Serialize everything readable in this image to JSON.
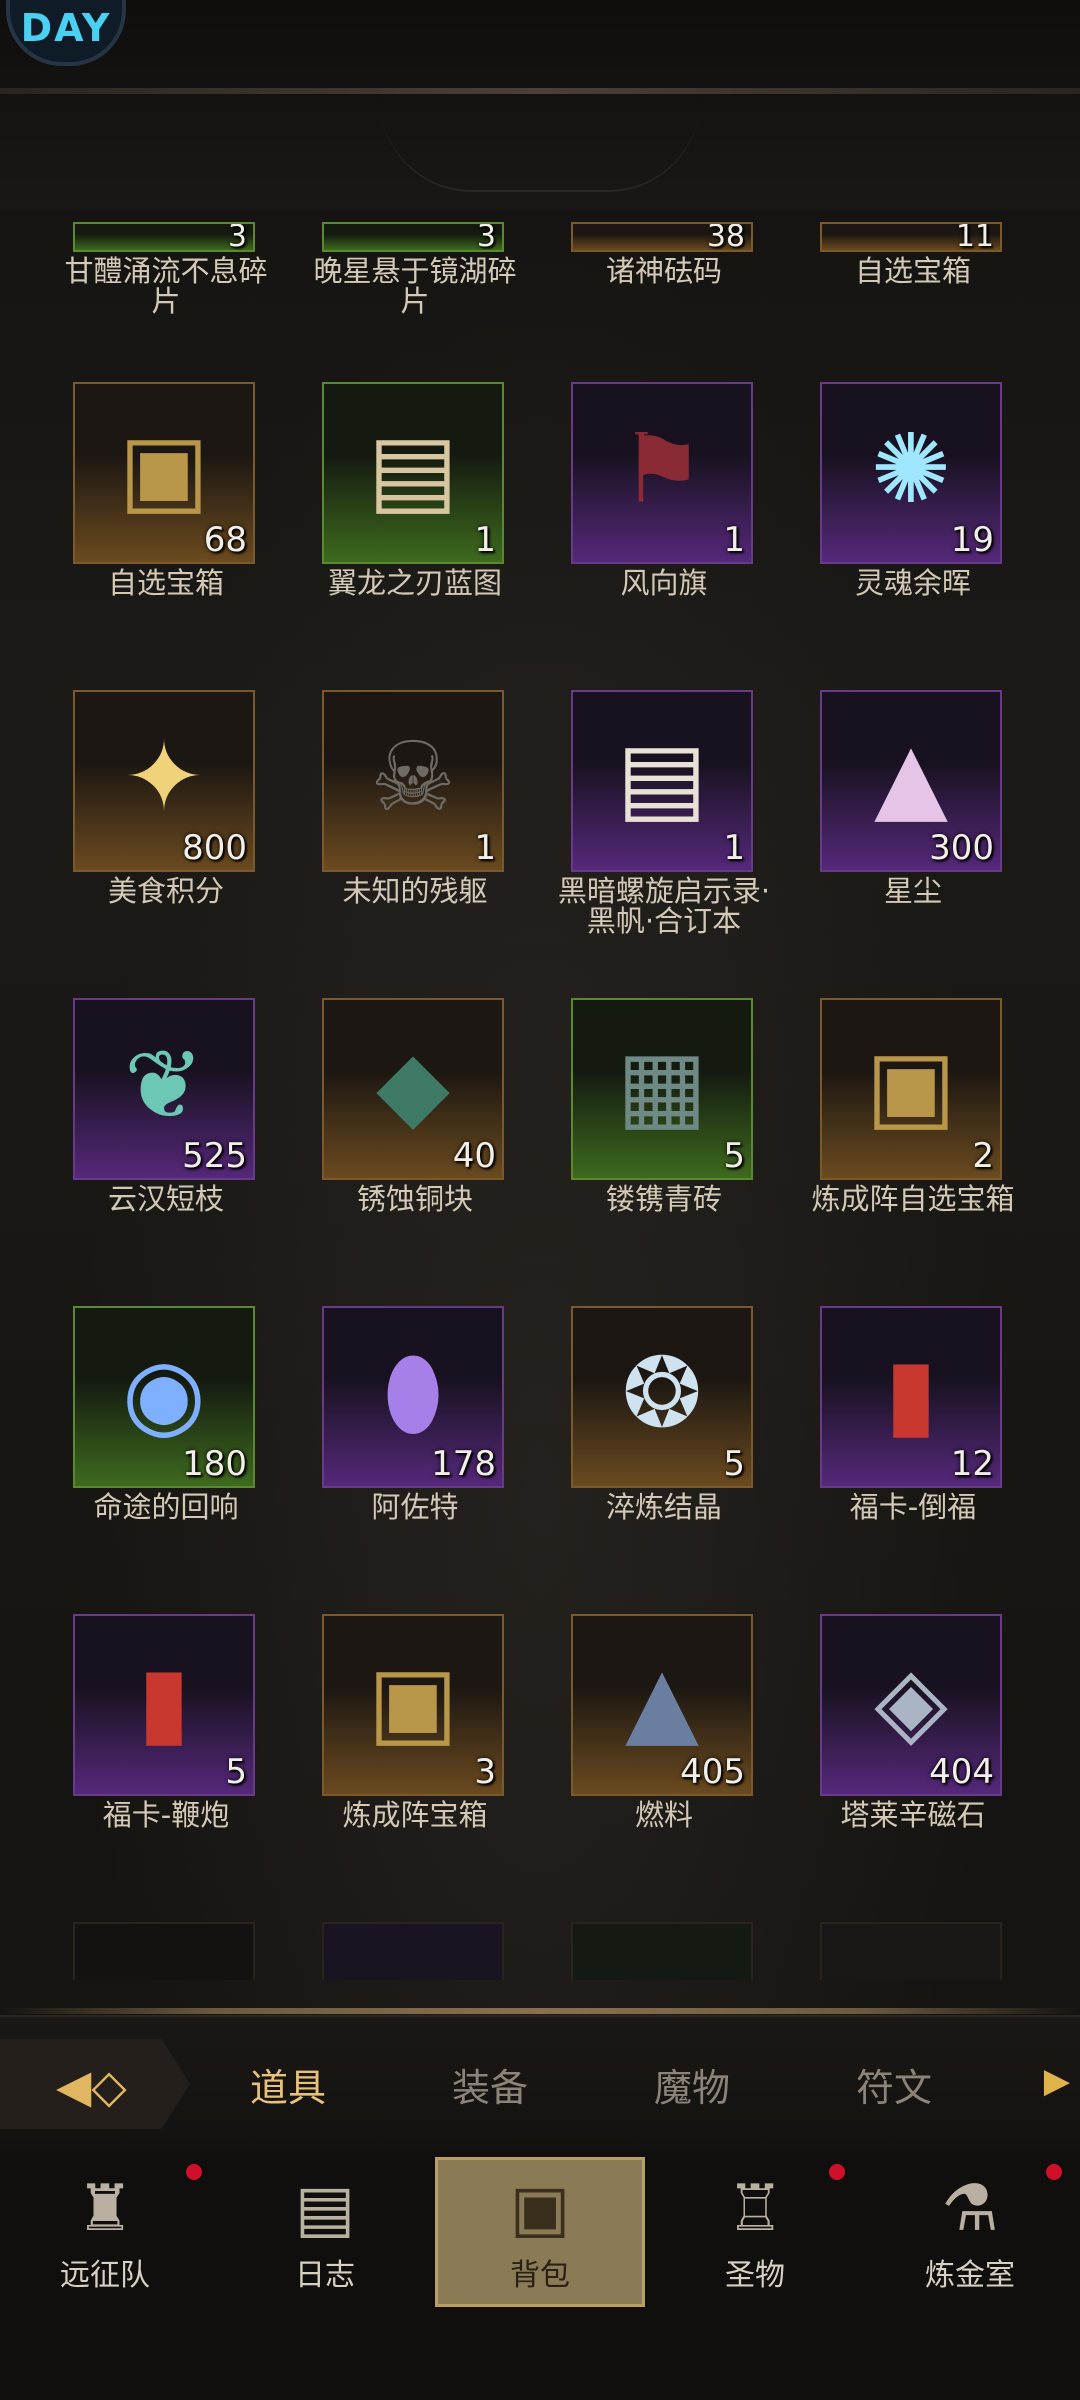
{
  "header": {
    "avatar_text": "DAY"
  },
  "inventory": {
    "row0": [
      {
        "name": "甘醴涌流不息碎片",
        "count": "3"
      },
      {
        "name": "晚星悬于镜湖碎片",
        "count": "3"
      },
      {
        "name": "诸神砝码",
        "count": "38"
      },
      {
        "name": "自选宝箱",
        "count": "11"
      }
    ],
    "row1": [
      {
        "name": "自选宝箱",
        "count": "68",
        "icon": "treasure-chest-icon"
      },
      {
        "name": "翼龙之刃蓝图",
        "count": "1",
        "icon": "scroll-blueprint-icon"
      },
      {
        "name": "风向旗",
        "count": "1",
        "icon": "banner-icon"
      },
      {
        "name": "灵魂余晖",
        "count": "19",
        "icon": "soul-glow-icon"
      }
    ],
    "row2": [
      {
        "name": "美食积分",
        "count": "800",
        "icon": "star-crystal-icon"
      },
      {
        "name": "未知的残躯",
        "count": "1",
        "icon": "skeleton-torso-icon"
      },
      {
        "name": "黑暗螺旋启示录·黑帆·合订本",
        "count": "1",
        "icon": "scroll-icon"
      },
      {
        "name": "星尘",
        "count": "300",
        "icon": "stardust-icon"
      }
    ],
    "row3": [
      {
        "name": "云汉短枝",
        "count": "525",
        "icon": "branch-icon"
      },
      {
        "name": "锈蚀铜块",
        "count": "40",
        "icon": "copper-ore-icon"
      },
      {
        "name": "镂镌青砖",
        "count": "5",
        "icon": "carved-brick-icon"
      },
      {
        "name": "炼成阵自选宝箱",
        "count": "2",
        "icon": "treasure-chest-icon"
      }
    ],
    "row4": [
      {
        "name": "命途的回响",
        "count": "180",
        "icon": "orb-flask-icon"
      },
      {
        "name": "阿佐特",
        "count": "178",
        "icon": "crystal-vial-icon"
      },
      {
        "name": "淬炼结晶",
        "count": "5",
        "icon": "rune-crystal-icon"
      },
      {
        "name": "福卡-倒福",
        "count": "12",
        "icon": "red-card-icon"
      }
    ],
    "row5": [
      {
        "name": "福卡-鞭炮",
        "count": "5",
        "icon": "red-card-icon"
      },
      {
        "name": "炼成阵宝箱",
        "count": "3",
        "icon": "treasure-chest-icon"
      },
      {
        "name": "燃料",
        "count": "405",
        "icon": "fuel-pile-icon"
      },
      {
        "name": "塔莱辛磁石",
        "count": "404",
        "icon": "lodestone-icon"
      }
    ]
  },
  "tabs": {
    "items": [
      "道具",
      "装备",
      "魔物",
      "符文"
    ],
    "active": "道具"
  },
  "nav": {
    "items": [
      {
        "label": "远征队",
        "badge": true
      },
      {
        "label": "日志",
        "badge": false
      },
      {
        "label": "背包",
        "badge": false,
        "active": true
      },
      {
        "label": "圣物",
        "badge": true
      },
      {
        "label": "炼金室",
        "badge": true
      }
    ]
  },
  "colors": {
    "accent": "#e8c27a",
    "badge": "#d0102a",
    "active_tab_bg": "#8a7a55"
  }
}
